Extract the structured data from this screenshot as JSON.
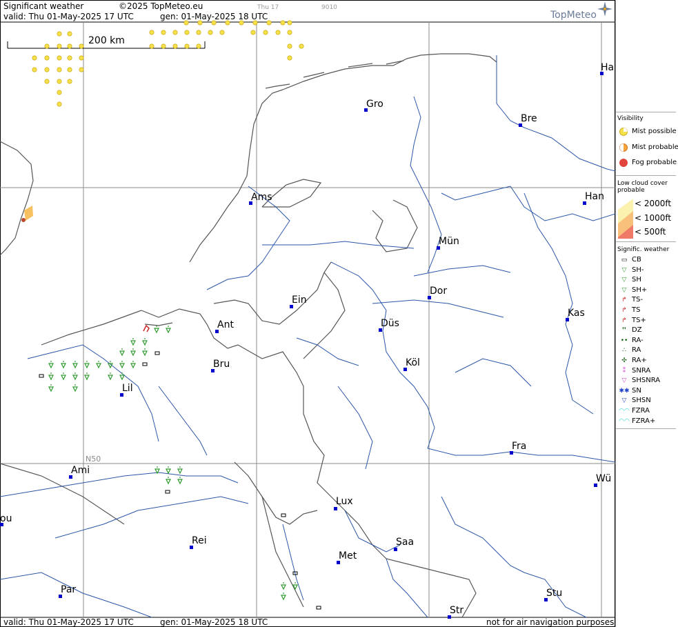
{
  "header": {
    "title": "Significant weather",
    "copyright": "©2025 TopMeteo.eu",
    "faint1": "Thu 17",
    "faint2": "9010",
    "valid": "valid:  Thu  01-May-2025  17 UTC",
    "generated": "gen: 01-May-2025 18 UTC",
    "logo": "TopMeteo"
  },
  "footer": {
    "valid": "valid:  Thu  01-May-2025  17 UTC",
    "generated": "gen: 01-May-2025 18 UTC",
    "disclaimer": "not for air navigation purposes"
  },
  "scale_label": "200 km",
  "grid_label": "N50",
  "cities": [
    "Gro",
    "Bre",
    "Ha",
    "Ams",
    "Han",
    "Mün",
    "Dor",
    "Ein",
    "Ant",
    "Düs",
    "Kas",
    "Bru",
    "Köl",
    "Lil",
    "Fra",
    "Ami",
    "Wü",
    "Lux",
    "ou",
    "Rei",
    "Saa",
    "Met",
    "Par",
    "Stu",
    "Str"
  ],
  "legend": {
    "visibility_title": "Visibility",
    "visibility": [
      "Mist possible",
      "Mist probable",
      "Fog probable"
    ],
    "lowcloud_title_1": "Low cloud cover",
    "lowcloud_title_2": "probable",
    "lowcloud": [
      "< 2000ft",
      "< 1000ft",
      "<   500ft"
    ],
    "sigwx_title": "Signific. weather",
    "sigwx": [
      "CB",
      "SH-",
      "SH",
      "SH+",
      "TS-",
      "TS",
      "TS+",
      "DZ",
      "RA-",
      "RA",
      "RA+",
      "SNRA",
      "SHSNRA",
      "SN",
      "SHSN",
      "FZRA",
      "FZRA+"
    ],
    "colors": {
      "mist_possible": "#f4e04a",
      "mist_probable": "#f7a43c",
      "fog_probable": "#e0443a",
      "shower": "#2f9a2f",
      "thunder": "#cc2222",
      "rain": "#0a5c0a",
      "snow_rain": "#cc44cc",
      "snow": "#2244cc",
      "freezing": "#22cccc"
    }
  }
}
